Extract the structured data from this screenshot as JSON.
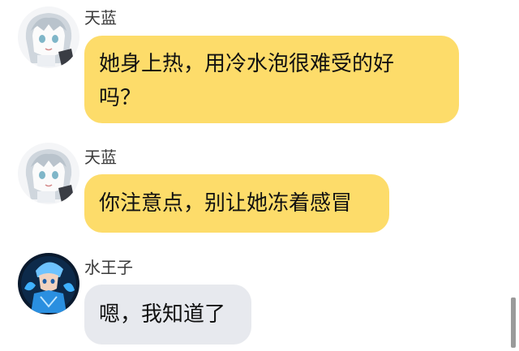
{
  "messages": [
    {
      "sender": "天蓝",
      "text_line1": "她身上热，用冷水泡很难受的好",
      "text_line2": "吗？",
      "bubble_color": "#fddc6a"
    },
    {
      "sender": "天蓝",
      "text": "你注意点，别让她冻着感冒",
      "bubble_color": "#fddc6a"
    },
    {
      "sender": "水王子",
      "text": "嗯，我知道了",
      "bubble_color": "#e7e9ee"
    }
  ]
}
